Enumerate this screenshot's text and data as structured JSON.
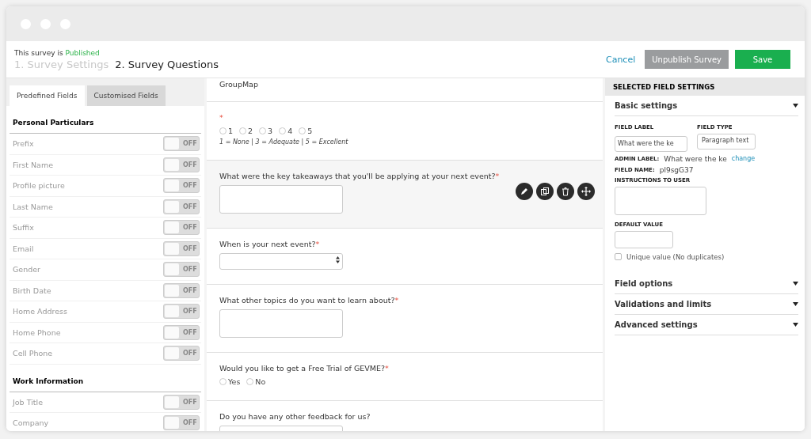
{
  "required_mark": "*",
  "header": {
    "status_prefix": "This survey is",
    "status": "Published",
    "steps": [
      {
        "label": "1. Survey Settings",
        "selected": false
      },
      {
        "label": "2. Survey Questions",
        "selected": true
      }
    ],
    "cancel": "Cancel",
    "unpublish": "Unpublish Survey",
    "save": "Save"
  },
  "sidebar": {
    "tabs": [
      {
        "label": "Predefined Fields",
        "selected": true
      },
      {
        "label": "Customised Fields",
        "selected": false
      }
    ],
    "sections": [
      {
        "title": "Personal Particulars",
        "items": [
          {
            "label": "Prefix",
            "on": false,
            "state_label": "OFF"
          },
          {
            "label": "First Name",
            "on": false,
            "state_label": "OFF"
          },
          {
            "label": "Profile picture",
            "on": false,
            "state_label": "OFF"
          },
          {
            "label": "Last Name",
            "on": false,
            "state_label": "OFF"
          },
          {
            "label": "Suffix",
            "on": false,
            "state_label": "OFF"
          },
          {
            "label": "Email",
            "on": false,
            "state_label": "OFF"
          },
          {
            "label": "Gender",
            "on": false,
            "state_label": "OFF"
          },
          {
            "label": "Birth Date",
            "on": false,
            "state_label": "OFF"
          },
          {
            "label": "Home Address",
            "on": false,
            "state_label": "OFF"
          },
          {
            "label": "Home Phone",
            "on": false,
            "state_label": "OFF"
          },
          {
            "label": "Cell Phone",
            "on": false,
            "state_label": "OFF"
          }
        ]
      },
      {
        "title": "Work Information",
        "items": [
          {
            "label": "Job Title",
            "on": false,
            "state_label": "OFF"
          },
          {
            "label": "Company",
            "on": false,
            "state_label": "OFF"
          }
        ]
      }
    ]
  },
  "questions": [
    {
      "kind": "text",
      "label": "GroupMap",
      "required": false,
      "selected": false
    },
    {
      "kind": "rating",
      "required": true,
      "selected": false,
      "options": [
        {
          "label": "1",
          "selected": false
        },
        {
          "label": "2",
          "selected": false
        },
        {
          "label": "3",
          "selected": false
        },
        {
          "label": "4",
          "selected": false
        },
        {
          "label": "5",
          "selected": false
        }
      ],
      "hint": "1 = None | 3 = Adequate | 5 = Excellent"
    },
    {
      "kind": "textarea",
      "label": "What were the key takeaways that you'll be applying at your next event?",
      "required": true,
      "selected": true
    },
    {
      "kind": "select",
      "label": "When is your next event?",
      "required": true,
      "selected": false
    },
    {
      "kind": "textarea",
      "label": "What other topics do you want to learn about?",
      "required": true,
      "selected": false
    },
    {
      "kind": "radio",
      "label": "Would you like to get a Free Trial of GEVME?",
      "required": true,
      "selected": false,
      "options": [
        {
          "label": "Yes",
          "selected": false
        },
        {
          "label": "No",
          "selected": false
        }
      ]
    },
    {
      "kind": "textarea",
      "label": "Do you have any other feedback for us?",
      "required": false,
      "selected": false
    }
  ],
  "settings": {
    "title": "SELECTED FIELD SETTINGS",
    "basic": {
      "title": "Basic settings",
      "expanded": true,
      "field_label": {
        "label": "FIELD LABEL",
        "value": "What were the ke"
      },
      "field_type": {
        "label": "FIELD TYPE",
        "value": "Paragraph text"
      },
      "admin_label": {
        "label": "ADMIN LABEL:",
        "value": "What were the ke",
        "link": "change"
      },
      "field_name": {
        "label": "FIELD NAME:",
        "value": "pl9sgG37"
      },
      "instructions": {
        "label": "INSTRUCTIONS TO USER"
      },
      "default_value": {
        "label": "DEFAULT VALUE"
      },
      "unique": {
        "label": "Unique value (No duplicates)",
        "checked": false
      }
    },
    "sections": [
      {
        "title": "Field options",
        "expanded": false
      },
      {
        "title": "Validations and limits",
        "expanded": false
      },
      {
        "title": "Advanced settings",
        "expanded": false
      }
    ]
  }
}
